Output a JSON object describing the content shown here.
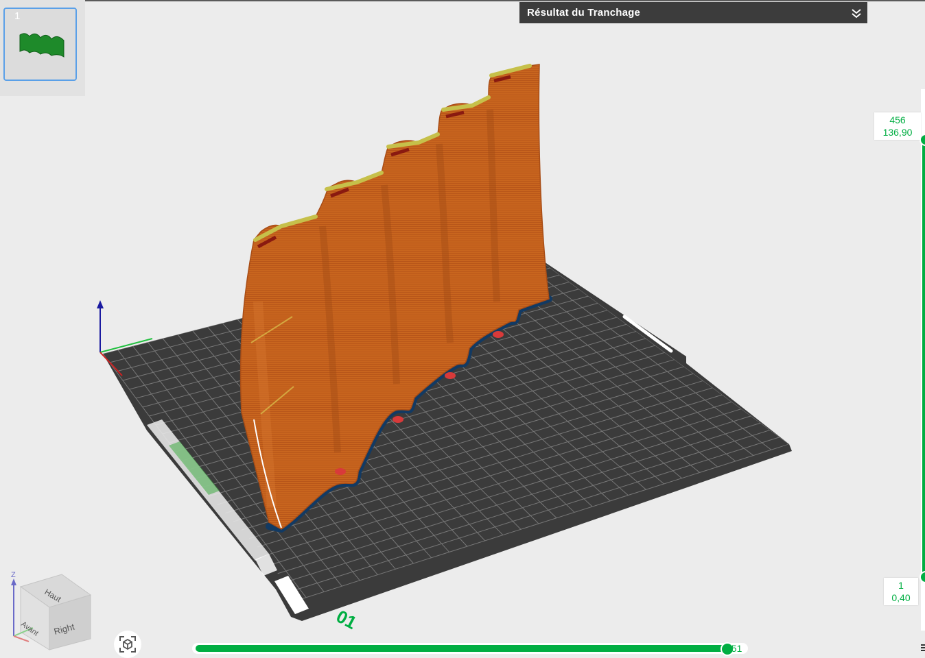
{
  "slice_panel": {
    "title": "Résultat du Tranchage"
  },
  "plate_thumbnail": {
    "number": "1"
  },
  "layer_slider": {
    "top_layer": "456",
    "top_height": "136,90",
    "bottom_layer": "1",
    "bottom_height": "0,40"
  },
  "move_slider": {
    "value": "751",
    "fraction": 0.97
  },
  "view_cube": {
    "top_label": "Haut",
    "front_label": "Avant",
    "right_label": "Right",
    "z_axis": "Z"
  },
  "plate": {
    "number_label": "01"
  },
  "colors": {
    "accent": "#00ae42",
    "model": "#c8651e",
    "skirt": "#123a63",
    "bed": "#3d3d3d",
    "grid": "#8a8a8a",
    "header": "#3c3c3c"
  },
  "icons": [
    "collapse-chevrons-icon",
    "fit-view-icon",
    "menu-icon"
  ]
}
